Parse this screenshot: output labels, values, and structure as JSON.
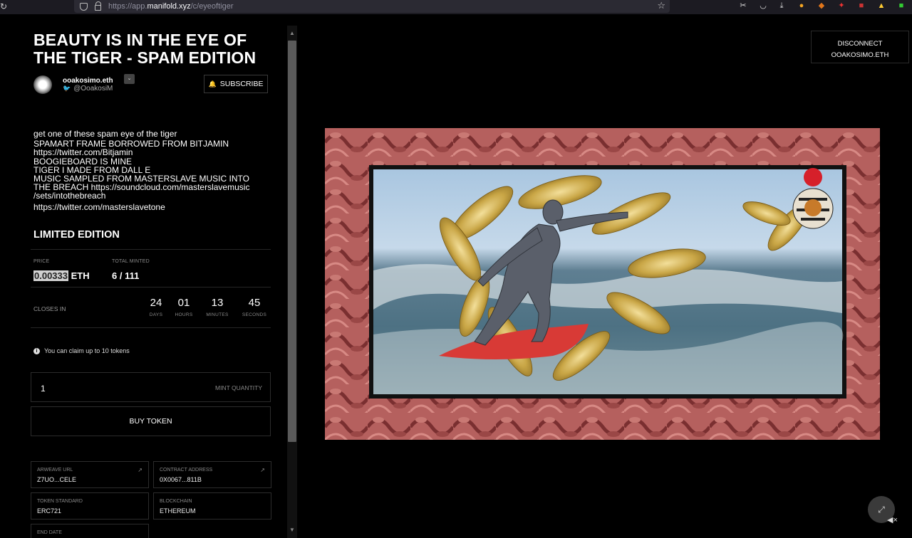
{
  "browser": {
    "url_prefix": "https://app.",
    "url_domain": "manifold.xyz",
    "url_path": "/c/eyeoftiger"
  },
  "artwork": {
    "title": "BEAUTY IS IN THE EYE OF THE TIGER - SPAM EDITION",
    "creator_name": "ooakosimo.eth",
    "creator_twitter": "@OoakosiM",
    "subscribe_label": "SUBSCRIBE",
    "description": [
      "get one of these spam eye of the tiger",
      "SPAMART FRAME BORROWED FROM BITJAMIN",
      "https://twitter.com/Bitjamin",
      "BOOGIEBOARD IS MINE",
      "TIGER I MADE FROM DALL E",
      "MUSIC SAMPLED FROM MASTERSLAVE MUSIC INTO",
      "THE BREACH https://soundcloud.com/masterslavemusic",
      "/sets/intothebreach",
      "https://twitter.com/masterslavetone"
    ]
  },
  "edition": {
    "heading": "LIMITED EDITION",
    "price_label": "PRICE",
    "price_value": "0.00333",
    "price_unit": "ETH",
    "minted_label": "TOTAL MINTED",
    "minted_value": "6 / 111",
    "closes_label": "CLOSES IN",
    "countdown": [
      {
        "value": "24",
        "unit": "DAYS"
      },
      {
        "value": "01",
        "unit": "HOURS"
      },
      {
        "value": "13",
        "unit": "MINUTES"
      },
      {
        "value": "45",
        "unit": "SECONDS"
      }
    ],
    "claim_note": "You can claim up to 10 tokens",
    "quantity_value": "1",
    "quantity_placeholder": "MINT QUANTITY",
    "buy_label": "BUY TOKEN"
  },
  "details": {
    "arweave_label": "ARWEAVE URL",
    "arweave_value": "Z7UO...CELE",
    "contract_label": "CONTRACT ADDRESS",
    "contract_value": "0X0067...811B",
    "standard_label": "TOKEN STANDARD",
    "standard_value": "ERC721",
    "chain_label": "BLOCKCHAIN",
    "chain_value": "ETHEREUM",
    "end_label": "END DATE"
  },
  "wallet": {
    "disconnect_label": "DISCONNECT",
    "address": "OOAKOSIMO.ETH"
  },
  "icons": {
    "link_icon": "↗",
    "expand_icon": "⤢",
    "mute_icon": "🔇"
  }
}
